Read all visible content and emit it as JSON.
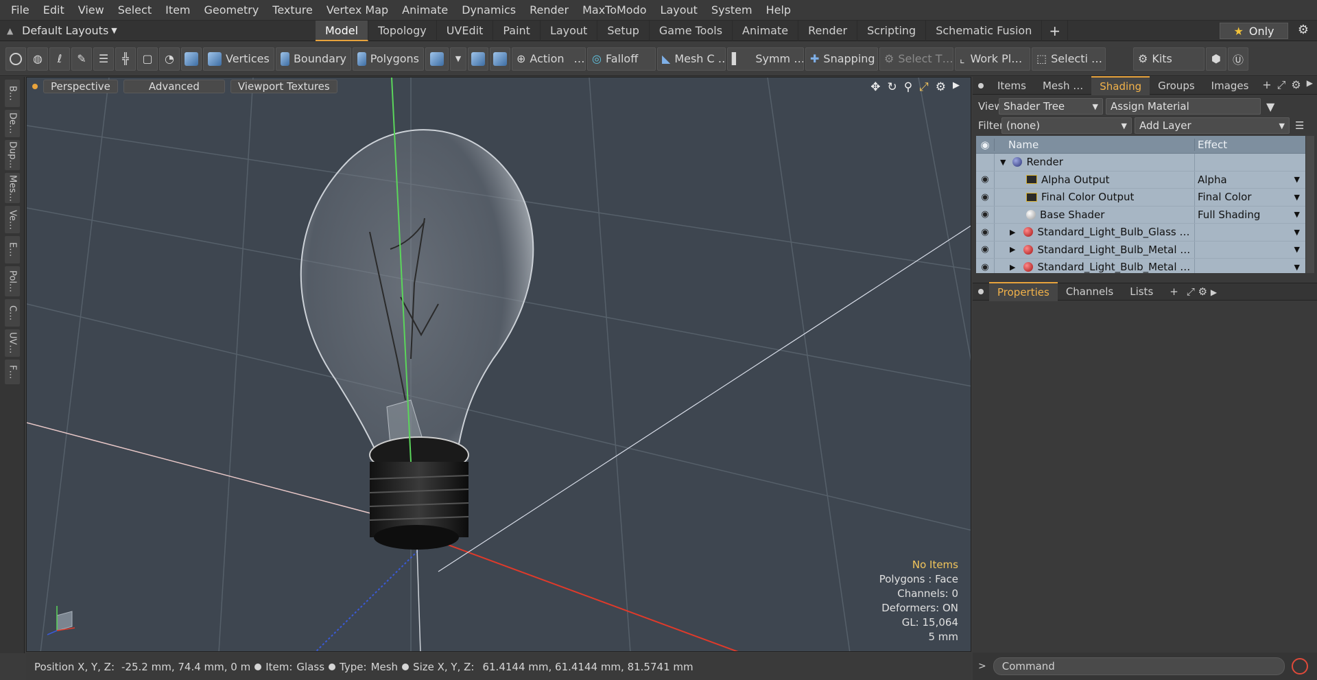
{
  "menu": [
    "File",
    "Edit",
    "View",
    "Select",
    "Item",
    "Geometry",
    "Texture",
    "Vertex Map",
    "Animate",
    "Dynamics",
    "Render",
    "MaxToModo",
    "Layout",
    "System",
    "Help"
  ],
  "layout_dropdown": "Default Layouts",
  "layout_tabs": [
    "Model",
    "Topology",
    "UVEdit",
    "Paint",
    "Layout",
    "Setup",
    "Game Tools",
    "Animate",
    "Render",
    "Scripting",
    "Schematic Fusion"
  ],
  "layout_tab_active": 0,
  "only_label": "Only",
  "toolbar": {
    "vertices": "Vertices",
    "boundary": "Boundary",
    "polygons": "Polygons",
    "action": "Action",
    "action_more": "…",
    "falloff": "Falloff",
    "meshc": "Mesh C …",
    "symm": "Symm …",
    "snapping": "Snapping",
    "selectt": "Select T…",
    "workpl": "Work Pl…",
    "selecti": "Selecti …",
    "kits": "Kits"
  },
  "left_tabs": [
    "B…",
    "De…",
    "Dup…",
    "Mes…",
    "Ve…",
    "E…",
    "Pol…",
    "C…",
    "UV…",
    "F…"
  ],
  "viewport": {
    "buttons": [
      "Perspective",
      "Advanced",
      "Viewport Textures"
    ],
    "info": [
      "No Items",
      "Polygons : Face",
      "Channels: 0",
      "Deformers: ON",
      "GL: 15,064",
      "5 mm"
    ]
  },
  "status": {
    "position_label": "Position X, Y, Z:",
    "position_value": "-25.2 mm, 74.4 mm, 0 m",
    "item_label": "Item:",
    "item_value": "Glass",
    "type_label": "Type:",
    "type_value": "Mesh",
    "size_label": "Size X, Y, Z:",
    "size_value": "61.4144 mm, 61.4144 mm, 81.5741 mm"
  },
  "right_tabs": [
    "Items",
    "Mesh …",
    "Shading",
    "Groups",
    "Images"
  ],
  "right_tab_active": 2,
  "shader": {
    "view_label": "View",
    "view_value": "Shader Tree",
    "assign_material": "Assign Material",
    "filter_label": "Filter",
    "filter_value": "(none)",
    "add_layer": "Add Layer",
    "col_name": "Name",
    "col_effect": "Effect",
    "rows": [
      {
        "name": "Render",
        "effect": ""
      },
      {
        "name": "Alpha Output",
        "effect": "Alpha"
      },
      {
        "name": "Final Color Output",
        "effect": "Final Color"
      },
      {
        "name": "Base Shader",
        "effect": "Full Shading"
      },
      {
        "name": "Standard_Light_Bulb_Glass …",
        "effect": ""
      },
      {
        "name": "Standard_Light_Bulb_Metal …",
        "effect": ""
      },
      {
        "name": "Standard_Light_Bulb_Metal …",
        "effect": ""
      }
    ]
  },
  "prop_tabs": [
    "Properties",
    "Channels",
    "Lists"
  ],
  "prop_tab_active": 0,
  "command_placeholder": "Command",
  "colors": {
    "accent": "#e8a33c",
    "viewport_bg": "#3e4650",
    "tree_bg": "#a7b6c4"
  }
}
